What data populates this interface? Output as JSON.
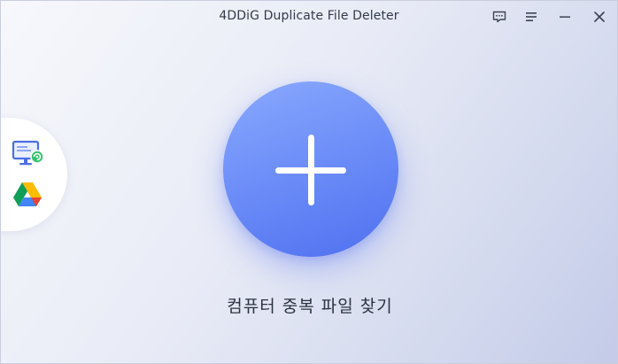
{
  "app": {
    "title": "4DDiG Duplicate File Deleter"
  },
  "titlebar": {
    "buttons": [
      {
        "name": "feedback",
        "icon": "feedback-icon"
      },
      {
        "name": "menu",
        "icon": "hamburger-menu-icon"
      },
      {
        "name": "minimize",
        "icon": "minimize-icon"
      },
      {
        "name": "close",
        "icon": "close-icon"
      }
    ]
  },
  "sidebar": {
    "items": [
      {
        "name": "computer",
        "icon": "computer-icon"
      },
      {
        "name": "google-drive",
        "icon": "google-drive-icon"
      }
    ]
  },
  "main": {
    "action_label": "컴퓨터 중복 파일 찾기",
    "action_icon": "plus-icon"
  },
  "colors": {
    "accent": "#6a8bf7",
    "accent_dark": "#4f70f0",
    "background_start": "#f7f8fc",
    "background_end": "#c3cbe8"
  }
}
